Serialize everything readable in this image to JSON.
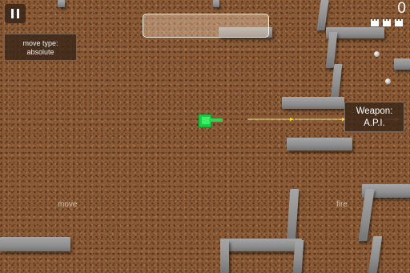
{
  "hud": {
    "move_type_label": "move type:",
    "move_type_value": "absolute",
    "score": "0",
    "lives_icon": "castle-icon",
    "lives_count": 3,
    "weapon_label": "Weapon:",
    "weapon_value": "A.P.I.",
    "move_label": "move",
    "fire_label": "fire"
  },
  "colors": {
    "ground": "#8a5a36",
    "wall": "#9a9a9a",
    "tank": "#22d64a",
    "projectile": "#f0e020"
  }
}
